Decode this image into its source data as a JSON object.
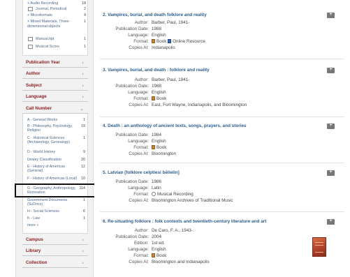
{
  "sidebar": {
    "formats": [
      {
        "label": "Audio Recording",
        "count": "18",
        "icon": "plus"
      },
      {
        "label": "Journal, Periodical",
        "count": "2",
        "icon": "journal-icon"
      },
      {
        "label": "Microformats",
        "count": "4",
        "icon": "plus"
      },
      {
        "label": "Mixed Materials, Three-dimensional objects",
        "count": "1",
        "icon": "plus"
      },
      {
        "label": "Manuscript",
        "count": "1",
        "icon": "manuscript-icon"
      },
      {
        "label": "Musical Score",
        "count": "1",
        "icon": "score-icon"
      }
    ],
    "facets_top": [
      "Publication Year",
      "Author",
      "Subject",
      "Language",
      "Call Number"
    ],
    "call_numbers": [
      {
        "label": "A - General Works",
        "count": "1"
      },
      {
        "label": "B - Philosophy, Psychology, Religion",
        "count": "19"
      },
      {
        "label": "C - Historical Sciences (Archaeology, Genealogy)",
        "count": "1"
      },
      {
        "label": "D - World History",
        "count": "9"
      },
      {
        "label": "Dewey Classification",
        "count": "20"
      },
      {
        "label": "E - History of Americas (General)",
        "count": "12"
      },
      {
        "label": "F - History of Americas (Local)",
        "count": "10"
      },
      {
        "label": "G - Geography, Anthropology, Recreation",
        "count": "114"
      },
      {
        "label": "Government Documents (SuDocs)",
        "count": "1"
      },
      {
        "label": "H - Social Sciences",
        "count": "6"
      },
      {
        "label": "K - Law",
        "count": "1"
      }
    ],
    "more": "more »",
    "facets_bottom": [
      "Campus",
      "Library",
      "Collection"
    ]
  },
  "results": [
    {
      "title": "2. Vampires, burial, and death folklore and reality",
      "fields": [
        {
          "key": "Author:",
          "value": "Barber, Paul, 1941-"
        },
        {
          "key": "Publication Date:",
          "value": "1988"
        },
        {
          "key": "Language:",
          "value": "English"
        },
        {
          "key": "Format:",
          "value": "Book",
          "value2": "Online Resource"
        },
        {
          "key": "Copies At:",
          "value": "Indianapolis"
        }
      ]
    },
    {
      "title": "3. Vampires, burial, and death : folklore and reality",
      "fields": [
        {
          "key": "Author:",
          "value": "Barber, Paul, 1941-"
        },
        {
          "key": "Publication Date:",
          "value": "1988"
        },
        {
          "key": "Language:",
          "value": "English"
        },
        {
          "key": "Format:",
          "value": "Book"
        },
        {
          "key": "Copies At:",
          "value": "East, Fort Wayne, Indianapolis, and Bloomington"
        }
      ]
    },
    {
      "title": "4. Death : an anthology of ancient texts, songs, prayers, and stories",
      "fields": [
        {
          "key": "Publication Date:",
          "value": "1984"
        },
        {
          "key": "Language:",
          "value": "English"
        },
        {
          "key": "Format:",
          "value": "Book"
        },
        {
          "key": "Copies At:",
          "value": "Bloomington"
        }
      ]
    },
    {
      "title": "5. Latvian [folklore celptiesi bēlielin]",
      "fields": [
        {
          "key": "Publication Date:",
          "value": "1986"
        },
        {
          "key": "Language:",
          "value": "Latin"
        },
        {
          "key": "Format:",
          "value": "Musical Recording"
        },
        {
          "key": "Copies At:",
          "value": "Bloomington Archives of Traditional Music"
        }
      ]
    },
    {
      "title": "6. Re-situating folklore : folk contexts and twentieth-century literature and art",
      "fields": [
        {
          "key": "Author:",
          "value": "De Caro, F. A., 1943-"
        },
        {
          "key": "Publication Date:",
          "value": "2004"
        },
        {
          "key": "Edition:",
          "value": "1st ed."
        },
        {
          "key": "Language:",
          "value": "English"
        },
        {
          "key": "Format:",
          "value": "Book"
        },
        {
          "key": "Copies At:",
          "value": "Bloomington and Indianapolis"
        }
      ]
    }
  ],
  "colors": {
    "facet_title": "#8a1c1c",
    "link": "#2d5e8c",
    "highlight_box": "#111111"
  }
}
